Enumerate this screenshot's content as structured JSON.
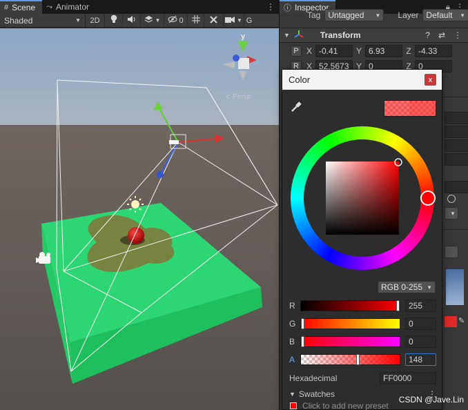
{
  "scene_window": {
    "tabs": [
      {
        "label": "Scene",
        "icon": "hash-icon"
      },
      {
        "label": "Animator",
        "icon": "animator-icon"
      }
    ],
    "toolbar": {
      "shading_mode": "Shaded",
      "mode_2d": "2D",
      "hidden_count": "0"
    },
    "gizmo": {
      "axis_y": "y",
      "projection_label": "Persp"
    }
  },
  "inspector": {
    "tab_label": "Inspector",
    "tag_label": "Tag",
    "tag_value": "Untagged",
    "layer_label": "Layer",
    "layer_value": "Default",
    "transform": {
      "title": "Transform",
      "position_btn": "P",
      "rotation_btn": "R",
      "position": {
        "x": "-0.41",
        "y": "6.93",
        "z": "-4.33"
      },
      "rotation": {
        "x": "52.5673",
        "y": "0",
        "z": "0"
      },
      "axis_x": "X",
      "axis_y": "Y",
      "axis_z": "Z"
    }
  },
  "color_picker": {
    "title": "Color",
    "close_label": "x",
    "mode": "RGB 0-255",
    "channels": [
      {
        "label": "R",
        "value": "255",
        "fraction": 1.0
      },
      {
        "label": "G",
        "value": "0",
        "fraction": 0.0
      },
      {
        "label": "B",
        "value": "0",
        "fraction": 0.0
      },
      {
        "label": "A",
        "value": "148",
        "fraction": 0.58
      }
    ],
    "hex_label": "Hexadecimal",
    "hex_value": "FF0000",
    "swatches_label": "Swatches",
    "swatches_hint": "Click to add new preset",
    "current_color": "#FF0000"
  },
  "watermark": "CSDN @Jave.Lin"
}
